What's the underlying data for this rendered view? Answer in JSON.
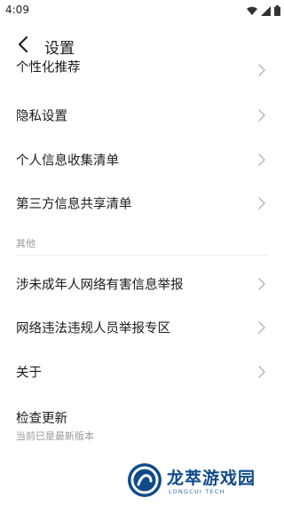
{
  "status_bar": {
    "time": "4:09",
    "icons": [
      "wifi-icon",
      "signal-icon",
      "battery-icon"
    ]
  },
  "header": {
    "title": "设置",
    "back_icon": "chevron-left-icon"
  },
  "rows": {
    "personalized": "个性化推荐",
    "privacy": "隐私设置",
    "personal_info": "个人信息收集清单",
    "third_party": "第三方信息共享清单"
  },
  "section_other": "其他",
  "rows_other": {
    "minor_report": "涉未成年人网络有害信息举报",
    "violation_report": "网络违法违规人员举报专区",
    "about": "关于"
  },
  "update": {
    "title": "检查更新",
    "subtitle": "当前已是最新版本"
  },
  "watermark": {
    "title": "龙萃游戏园",
    "subtitle": "LONGCUI TECH"
  },
  "colors": {
    "accent": "#0e4a8a",
    "text": "#1a1a1a",
    "secondary": "#9a9a9a",
    "chevron": "#b8b8b8"
  }
}
